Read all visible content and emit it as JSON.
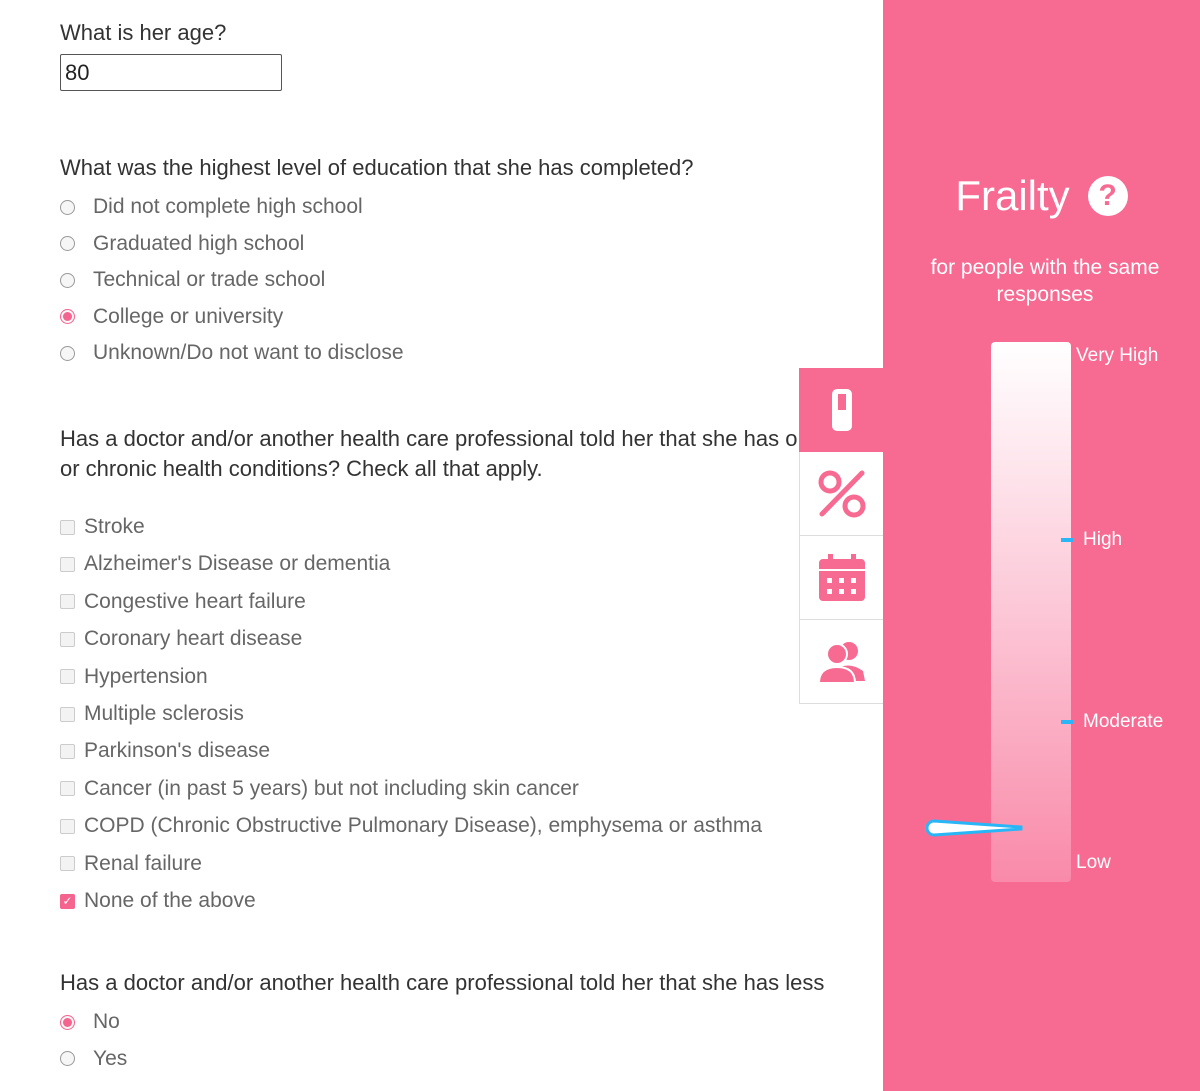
{
  "age": {
    "question": "What is her age?",
    "value": "80"
  },
  "education": {
    "question": "What was the highest level of education that she has completed?",
    "options": [
      {
        "label": "Did not complete high school",
        "selected": false
      },
      {
        "label": "Graduated high school",
        "selected": false
      },
      {
        "label": "Technical or trade school",
        "selected": false
      },
      {
        "label": "College or university",
        "selected": true
      },
      {
        "label": "Unknown/Do not want to disclose",
        "selected": false
      }
    ]
  },
  "conditions": {
    "question_line1": "Has a doctor and/or another health care professional told her that she has one",
    "question_line2": "or chronic health conditions? Check all that apply.",
    "options": [
      {
        "label": "Stroke",
        "checked": false
      },
      {
        "label": "Alzheimer's Disease or dementia",
        "checked": false
      },
      {
        "label": "Congestive heart failure",
        "checked": false
      },
      {
        "label": "Coronary heart disease",
        "checked": false
      },
      {
        "label": "Hypertension",
        "checked": false
      },
      {
        "label": "Multiple sclerosis",
        "checked": false
      },
      {
        "label": "Parkinson's disease",
        "checked": false
      },
      {
        "label": "Cancer (in past 5 years) but not including skin cancer",
        "checked": false
      },
      {
        "label": "COPD (Chronic Obstructive Pulmonary Disease), emphysema or asthma",
        "checked": false
      },
      {
        "label": "Renal failure",
        "checked": false
      },
      {
        "label": "None of the above",
        "checked": true
      }
    ]
  },
  "last_question": {
    "question": "Has a doctor and/or another health care professional told her that she has less",
    "options": [
      {
        "label": "No",
        "selected": true
      },
      {
        "label": "Yes",
        "selected": false
      }
    ]
  },
  "tabs": [
    {
      "icon": "thermometer-icon",
      "active": true
    },
    {
      "icon": "percent-icon",
      "active": false
    },
    {
      "icon": "calendar-icon",
      "active": false
    },
    {
      "icon": "people-icon",
      "active": false
    }
  ],
  "panel": {
    "title": "Frailty",
    "help_icon": "?",
    "subtitle": "for people with the same responses",
    "scale_labels": [
      "Very High",
      "High",
      "Moderate",
      "Low"
    ],
    "needle_level": 0.1
  },
  "colors": {
    "accent": "#f76b93",
    "needle": "#29b6f6"
  }
}
